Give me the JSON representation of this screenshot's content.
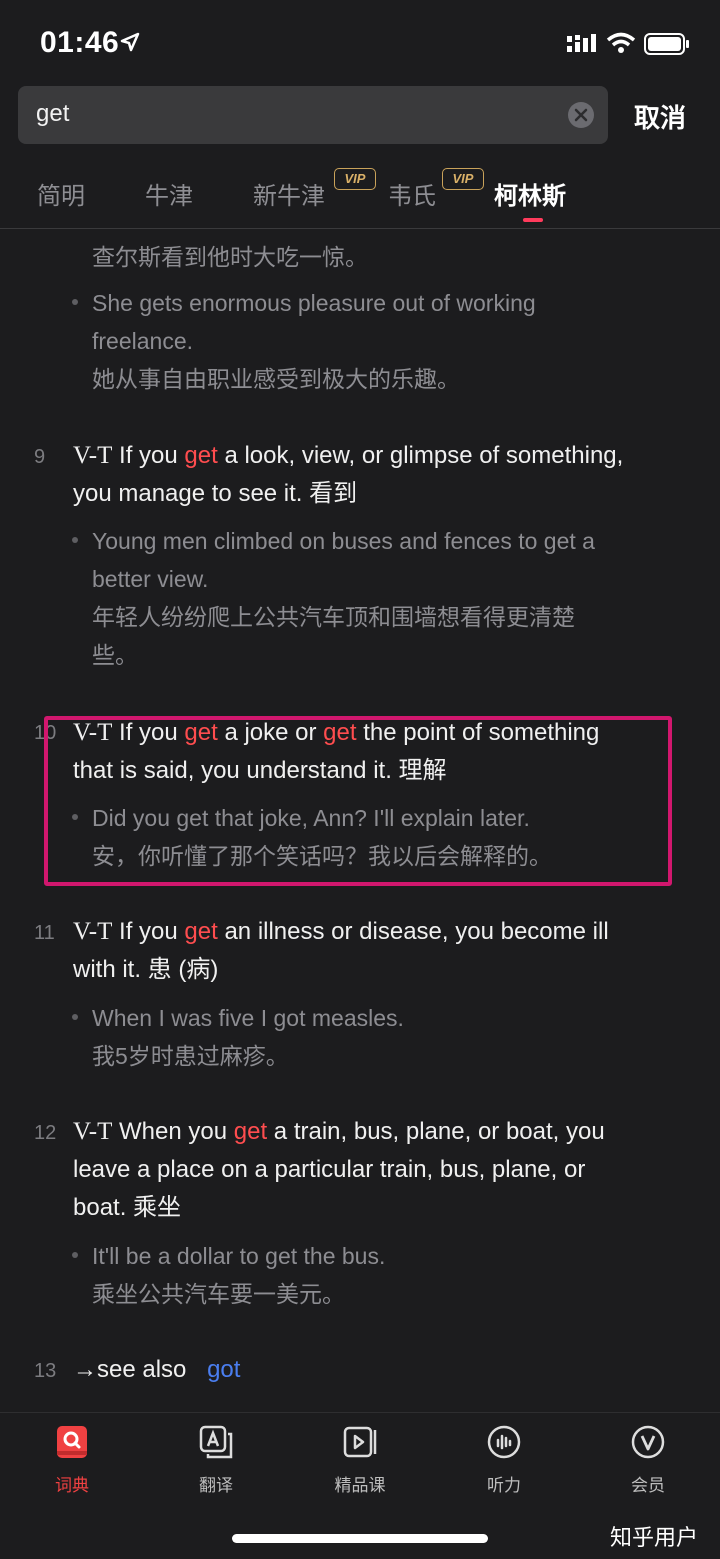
{
  "status": {
    "time": "01:46"
  },
  "search": {
    "query": "get",
    "cancel": "取消"
  },
  "tabs": [
    {
      "label": "简明"
    },
    {
      "label": "牛津"
    },
    {
      "label": "新牛津",
      "badge": "VIP"
    },
    {
      "label": "韦氏",
      "badge": "VIP"
    },
    {
      "label": "柯林斯",
      "active": true
    }
  ],
  "entries": {
    "prev_ex1_cn": "查尔斯看到他时大吃一惊。",
    "prev_ex2_en1": "She gets enormous pleasure out of working",
    "prev_ex2_en2": "freelance.",
    "prev_ex2_cn": "她从事自由职业感受到极大的乐趣。",
    "e9": {
      "num": "9",
      "pos": "V-T",
      "l1a": "If you ",
      "kw": "get",
      "l1b": " a look, view, or glimpse of something,",
      "l2": "you manage to see it. 看到",
      "ex_en1": "Young men climbed on buses and fences to get a",
      "ex_en2": "better view.",
      "ex_cn1": "年轻人纷纷爬上公共汽车顶和围墙想看得更清楚",
      "ex_cn2": "些。"
    },
    "e10": {
      "num": "10",
      "pos": "V-T",
      "l1a": "If you ",
      "kw": "get",
      "l1b": " a joke or ",
      "kw2": "get",
      "l1c": " the point of something",
      "l2": "that is said, you understand it. 理解",
      "ex_en": "Did you get that joke, Ann? I'll explain later.",
      "ex_cn": "安，你听懂了那个笑话吗？我以后会解释的。"
    },
    "e11": {
      "num": "11",
      "pos": "V-T",
      "l1a": "If you ",
      "kw": "get",
      "l1b": " an illness or disease, you become ill",
      "l2": "with it. 患 (病)",
      "ex_en": "When I was five I got measles.",
      "ex_cn": "我5岁时患过麻疹。"
    },
    "e12": {
      "num": "12",
      "pos": "V-T",
      "l1a": "When you ",
      "kw": "get",
      "l1b": " a train, bus, plane, or boat, you",
      "l2": "leave a place on a particular train, bus, plane, or",
      "l3": "boat. 乘坐",
      "ex_en": "It'll be a dollar to get the bus.",
      "ex_cn": "乘坐公共汽车要一美元。"
    },
    "e13": {
      "num": "13",
      "see_also": "→see also",
      "link": "got"
    }
  },
  "bottom_nav": [
    {
      "label": "词典",
      "icon": "dictionary-icon",
      "active": true
    },
    {
      "label": "翻译",
      "icon": "translate-icon"
    },
    {
      "label": "精品课",
      "icon": "course-icon"
    },
    {
      "label": "听力",
      "icon": "listening-icon"
    },
    {
      "label": "会员",
      "icon": "vip-member-icon"
    }
  ],
  "watermark": "知乎用户",
  "colors": {
    "keyword": "#ff4d4f",
    "link": "#4a7ef0",
    "highlight_box": "#d1176e",
    "active_tab": "#ff3b5c"
  }
}
